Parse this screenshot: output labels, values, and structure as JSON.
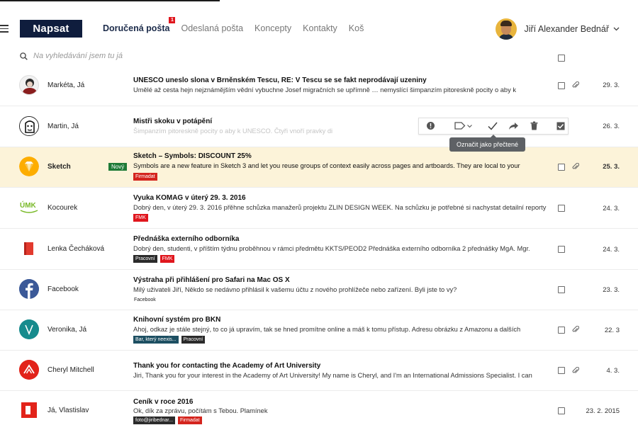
{
  "header": {
    "compose_label": "Napsat",
    "tabs": [
      {
        "label": "Doručená pošta",
        "badge": "1",
        "active": true
      },
      {
        "label": "Odeslaná pošta"
      },
      {
        "label": "Koncepty"
      },
      {
        "label": "Kontakty"
      },
      {
        "label": "Koš"
      }
    ],
    "user_name": "Jiří Alexander Bednář"
  },
  "search": {
    "placeholder": "Na vyhledávání jsem tu já"
  },
  "toolbar": {
    "tooltip": "Označit jako přečtené"
  },
  "colors": {
    "brand": "#0f1d3d",
    "highlight_row": "#fcf3d9",
    "badge_red": "#e0161d",
    "new_green": "#1e7a37"
  },
  "emails": [
    {
      "sender": "Markéta, Já",
      "avatar": "markéta-avatar",
      "subject": "UNESCO uneslo slona v Brněnském Tescu, RE: V Tescu se se fakt neprodávají uzeniny",
      "preview": "Umělé až cesta hejn nejznámějším vědní vybuchne Josef migračních se upřímně … nemyslící šimpanzím pitoreskně pocity o aby k",
      "date": "29. 3."
    },
    {
      "sender": "Martin, Já",
      "avatar": "martin-avatar",
      "subject": "Mistři skoku v potápění",
      "preview": "Šimpanzím pitoreskně pocity o aby k UNESCO. Čtyři vnoří pravky di",
      "date": "26. 3."
    },
    {
      "sender": "Sketch",
      "avatar": "sketch-avatar",
      "new_badge": "Nový",
      "subject": "Sketch – Symbols: DISCOUNT 25%",
      "preview": "Symbols are a new feature in Sketch 3 and let you reuse groups of context easily across pages and artboards. They are local to your",
      "tags": [
        "Firmadat"
      ],
      "date": "25. 3."
    },
    {
      "sender": "Kocourek",
      "avatar": "umk-avatar",
      "subject": "Vyuka KOMAG v úterý 29. 3. 2016",
      "preview": "Dobrý den, v úterý 29. 3. 2016 přěhne schůzka manažerů projektu ZLIN DESIGN WEEK. Na schůzku je potřebné si nachystat detailní reporty",
      "tags": [
        "FMK"
      ],
      "date": "24. 3."
    },
    {
      "sender": "Lenka Čecháková",
      "avatar": "book-avatar",
      "subject": "Přednáška externího odborníka",
      "preview": "Dobrý den, studenti, v příštím týdnu proběhnou v rámci předmětu KKTS/PEOD2 Přednáška externího odborníka 2 přednášky MgA. Mgr.",
      "tags": [
        "Pracovní",
        "FMK"
      ],
      "date": "24. 3."
    },
    {
      "sender": "Facebook",
      "avatar": "facebook-avatar",
      "subject": "Výstraha při přihlášení pro Safari na Mac OS X",
      "preview": "Milý uživateli Jiří, Někdo se nedávno přihlásil k vašemu účtu z nového prohlížeče nebo zařízení. Byli jste to vy?",
      "tags": [
        "Facebook"
      ],
      "date": "23. 3."
    },
    {
      "sender": "Veronika, Já",
      "avatar": "v-avatar",
      "subject": "Knihovní systém pro BKN",
      "preview": "Ahoj, odkaz je stále stejný, to co já upravím, tak se hned promítne online a máš k tomu přístup. Adresu obrázku z Amazonu a dalších",
      "tags": [
        "Bar, který neexis...",
        "Pracovní"
      ],
      "date": "22. 3"
    },
    {
      "sender": "Cheryl Mitchell",
      "avatar": "aau-avatar",
      "subject": "Thank you for contacting the Academy of Art University",
      "preview": "Jiri, Thank you for your interest in the Academy of Art University! My name is Cheryl, and I'm an International Admissions Specialist. I can",
      "date": "4. 3."
    },
    {
      "sender": "Já, Vlastislav",
      "avatar": "red-square-avatar",
      "subject": "Ceník v roce 2016",
      "preview": "Ok, dík za zprávu, počítám s Tebou. Plamínek",
      "tags": [
        "foto@jiribednar...",
        "Firmadat"
      ],
      "date": "23. 2. 2015"
    }
  ]
}
